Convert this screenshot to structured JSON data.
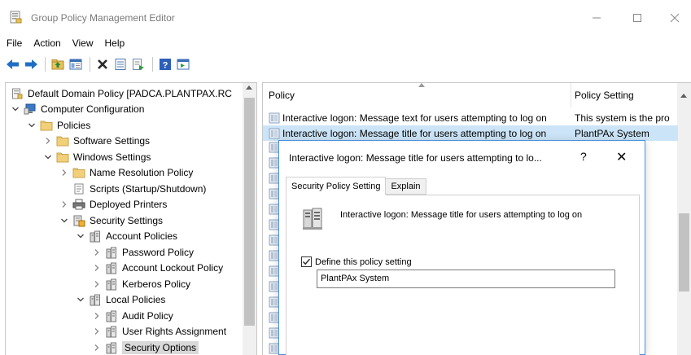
{
  "window": {
    "title": "Group Policy Management Editor",
    "minimize": "—",
    "maximize": "☐",
    "close": "✕"
  },
  "menu": [
    "File",
    "Action",
    "View",
    "Help"
  ],
  "toolbar": {
    "icons": [
      "back-icon",
      "forward-icon",
      "folder-up-icon",
      "show-hide-tree-icon",
      "delete-icon",
      "properties-icon",
      "export-list-icon",
      "help-icon",
      "view-icon"
    ]
  },
  "tree": [
    {
      "label": "Default Domain Policy [PADCA.PLANTPAX.RC",
      "level": 0,
      "expander": "",
      "icon": "gpo-icon"
    },
    {
      "label": "Computer Configuration",
      "level": 0,
      "expander": "v",
      "icon": "computer-icon"
    },
    {
      "label": "Policies",
      "level": 1,
      "expander": "v",
      "icon": "folder-icon"
    },
    {
      "label": "Software Settings",
      "level": 2,
      "expander": ">",
      "icon": "folder-icon"
    },
    {
      "label": "Windows Settings",
      "level": 2,
      "expander": "v",
      "icon": "folder-icon"
    },
    {
      "label": "Name Resolution Policy",
      "level": 3,
      "expander": ">",
      "icon": "folder-icon"
    },
    {
      "label": "Scripts (Startup/Shutdown)",
      "level": 3,
      "expander": "",
      "icon": "script-icon"
    },
    {
      "label": "Deployed Printers",
      "level": 3,
      "expander": ">",
      "icon": "printer-icon"
    },
    {
      "label": "Security Settings",
      "level": 3,
      "expander": "v",
      "icon": "security-icon"
    },
    {
      "label": "Account Policies",
      "level": 4,
      "expander": "v",
      "icon": "policy-folder-icon"
    },
    {
      "label": "Password Policy",
      "level": 5,
      "expander": ">",
      "icon": "policy-folder-icon"
    },
    {
      "label": "Account Lockout Policy",
      "level": 5,
      "expander": ">",
      "icon": "policy-folder-icon"
    },
    {
      "label": "Kerberos Policy",
      "level": 5,
      "expander": ">",
      "icon": "policy-folder-icon"
    },
    {
      "label": "Local Policies",
      "level": 4,
      "expander": "v",
      "icon": "policy-folder-icon"
    },
    {
      "label": "Audit Policy",
      "level": 5,
      "expander": ">",
      "icon": "policy-folder-icon"
    },
    {
      "label": "User Rights Assignment",
      "level": 5,
      "expander": ">",
      "icon": "policy-folder-icon"
    },
    {
      "label": "Security Options",
      "level": 5,
      "expander": ">",
      "icon": "policy-folder-icon",
      "selected": true
    }
  ],
  "list": {
    "headers": {
      "policy": "Policy",
      "setting": "Policy Setting"
    },
    "rows": [
      {
        "policy": "Interactive logon: Message text for users attempting to log on",
        "setting": "This system is the pro",
        "selected": false
      },
      {
        "policy": "Interactive logon: Message title for users attempting to log on",
        "setting": "PlantPAx System",
        "selected": true
      }
    ],
    "hidden_row_icon_count": 14
  },
  "dialog": {
    "title": "Interactive logon: Message title for users attempting to lo...",
    "help": "?",
    "close": "✕",
    "tabs": [
      "Security Policy Setting",
      "Explain"
    ],
    "policy_name": "Interactive logon: Message title for users attempting to log on",
    "define_label": "Define this policy setting",
    "define_checked": true,
    "value": "PlantPAx System"
  },
  "colors": {
    "selected_row": "#cce4f7",
    "dialog_border": "#4a90d9",
    "folder": "#e8c25a"
  }
}
